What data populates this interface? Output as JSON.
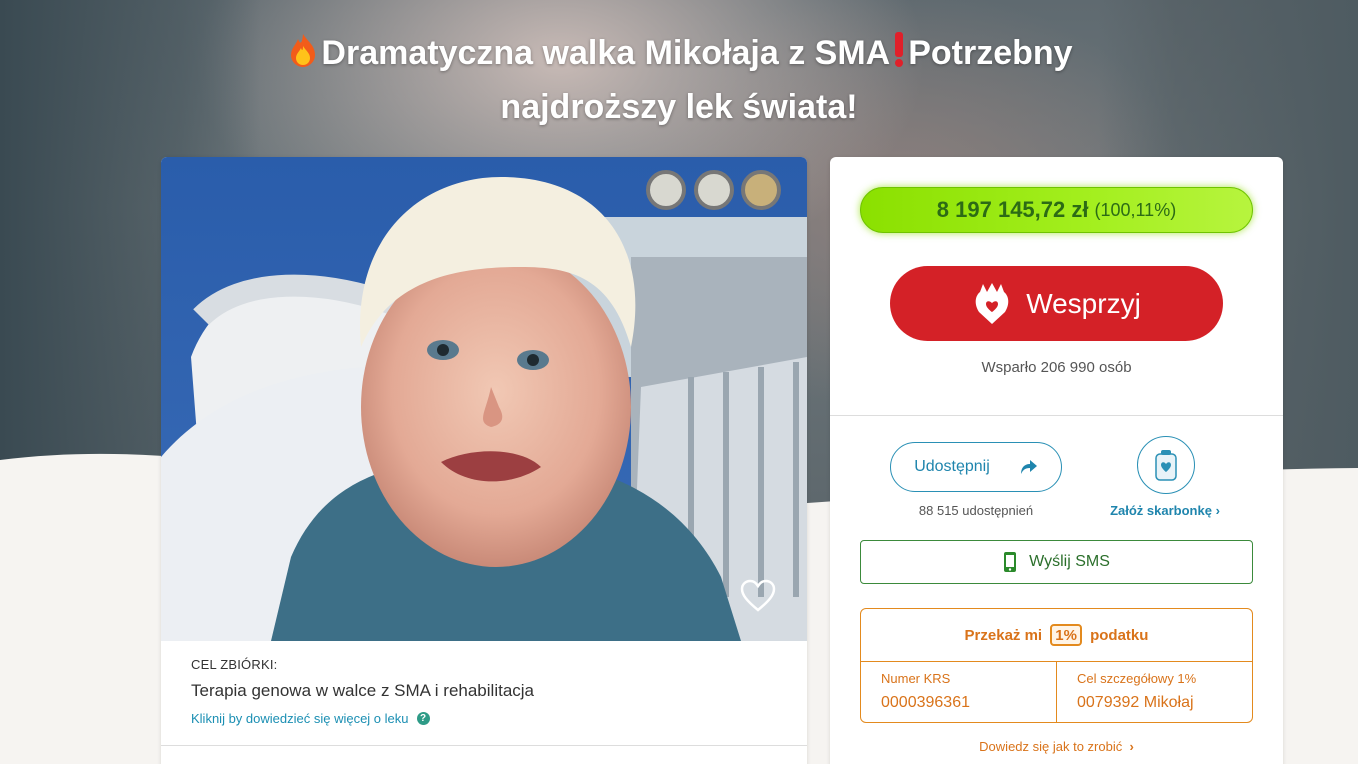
{
  "hero": {
    "title_line1": "Dramatyczna walka Mikołaja z SMA",
    "title_line1_end": "Potrzebny",
    "title_line2": "najdroższy lek świata!"
  },
  "campaign": {
    "goal_label": "CEL ZBIÓRKI:",
    "goal_title": "Terapia genowa w walce z SMA i rehabilitacja",
    "goal_link": "Kliknij by dowiedzieć się więcej o leku",
    "help_glyph": "?"
  },
  "donation": {
    "amount": "8 197 145,72 zł",
    "percent": "(100,11%)",
    "donate_label": "Wesprzyj",
    "supporters": "Wsparło 206 990 osób",
    "share_label": "Udostępnij",
    "share_count": "88 515 udostępnień",
    "piggy_link": "Załóż skarbonkę",
    "sms_label": "Wyślij SMS"
  },
  "tax": {
    "heading_before": "Przekaż mi",
    "badge": "1%",
    "heading_after": "podatku",
    "krs_label": "Numer KRS",
    "krs_value": "0000396361",
    "goal_label": "Cel szczegółowy 1%",
    "goal_value": "0079392 Mikołaj",
    "howto_link": "Dowiedz się jak to zrobić"
  },
  "icons": {
    "title_start": "fire-icon",
    "title_mid": "exclamation-icon",
    "donate": "heart-hand-icon",
    "share": "share-arrow-icon",
    "piggy": "piggy-bank-icon",
    "sms": "phone-icon",
    "favorite": "heart-outline-icon"
  },
  "colors": {
    "donate_red": "#d42127",
    "progress_green": "#8be000",
    "link_blue": "#1f85ad",
    "tax_orange": "#d9731a",
    "sms_green": "#2b6f2b"
  }
}
